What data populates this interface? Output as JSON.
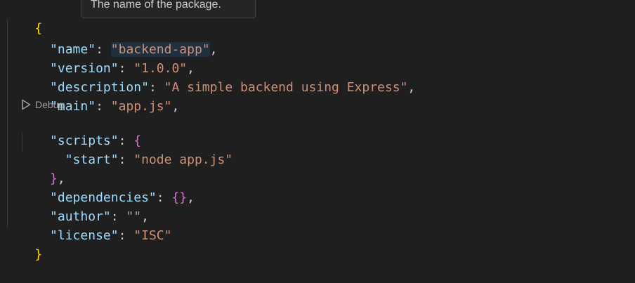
{
  "tooltip": {
    "text": "The name of the package."
  },
  "codelens": {
    "label": "Debug",
    "icon": "play-outline-icon"
  },
  "json": {
    "open_brace": "{",
    "close_brace": "}",
    "name": {
      "key": "\"name\"",
      "value": "\"backend-app\""
    },
    "version": {
      "key": "\"version\"",
      "value": "\"1.0.0\""
    },
    "description": {
      "key": "\"description\"",
      "value": "\"A simple backend using Express\""
    },
    "main": {
      "key": "\"main\"",
      "value": "\"app.js\""
    },
    "scripts": {
      "key": "\"scripts\"",
      "open": "{",
      "close": "}",
      "start": {
        "key": "\"start\"",
        "value": "\"node app.js\""
      }
    },
    "dependencies": {
      "key": "\"dependencies\"",
      "value": "{}"
    },
    "author": {
      "key": "\"author\"",
      "value": "\"\""
    },
    "license": {
      "key": "\"license\"",
      "value": "\"ISC\""
    }
  },
  "colors": {
    "background": "#1f1f1f",
    "key": "#9cdcfe",
    "string": "#ce9178",
    "brace_outer": "#ffd700",
    "brace_inner": "#da70d6"
  }
}
